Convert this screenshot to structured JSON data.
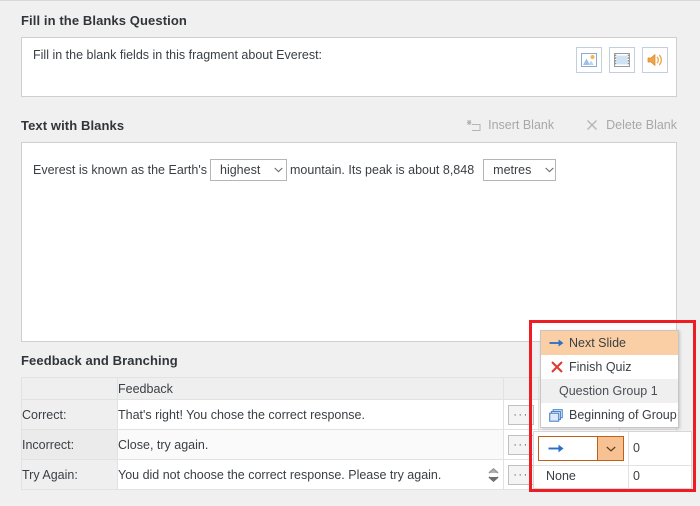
{
  "question": {
    "title": "Fill in the Blanks Question",
    "text": "Fill in the blank fields in this fragment about Everest:",
    "media_buttons": [
      {
        "name": "picture-icon",
        "label": "Picture"
      },
      {
        "name": "video-icon",
        "label": "Video"
      },
      {
        "name": "audio-icon",
        "label": "Audio"
      }
    ]
  },
  "blanks": {
    "title": "Text with Blanks",
    "insert_blank": "Insert Blank",
    "delete_blank": "Delete Blank",
    "sentence": {
      "part1": "Everest is known as the Earth's",
      "blank1": "highest",
      "part2": "mountain. Its peak is about 8,848",
      "blank2": "metres"
    }
  },
  "feedback": {
    "title": "Feedback and Branching",
    "columns": [
      "",
      "Feedback",
      "",
      "",
      ""
    ],
    "rows": [
      {
        "label": "Correct:",
        "text": "That's right! You chose the correct response.",
        "more": "···"
      },
      {
        "label": "Incorrect:",
        "text": "Close, try again.",
        "more": "···"
      },
      {
        "label": "Try Again:",
        "text": "You did not choose the correct response. Please try again.",
        "more": "···"
      }
    ]
  },
  "branching": {
    "combo_value": "",
    "combo_icon": "arrow-right-icon",
    "score_1": "0",
    "none_label": "None",
    "score_2": "0"
  },
  "branch_menu": {
    "items": [
      {
        "label": "Next Slide",
        "icon": "arrow-right-icon",
        "selected": true,
        "type": "item"
      },
      {
        "label": "Finish Quiz",
        "icon": "red-x-icon",
        "selected": false,
        "type": "item"
      },
      {
        "label": "Question Group 1",
        "icon": "",
        "selected": false,
        "type": "group"
      },
      {
        "label": "Beginning of Group",
        "icon": "stacked-layers-icon",
        "selected": false,
        "type": "item"
      }
    ]
  },
  "colors": {
    "highlight_red": "#ee1c23",
    "selection_orange": "#fbcfa5",
    "accent_blue": "#2a6fc9",
    "panel_bg": "#f0f0f0"
  }
}
